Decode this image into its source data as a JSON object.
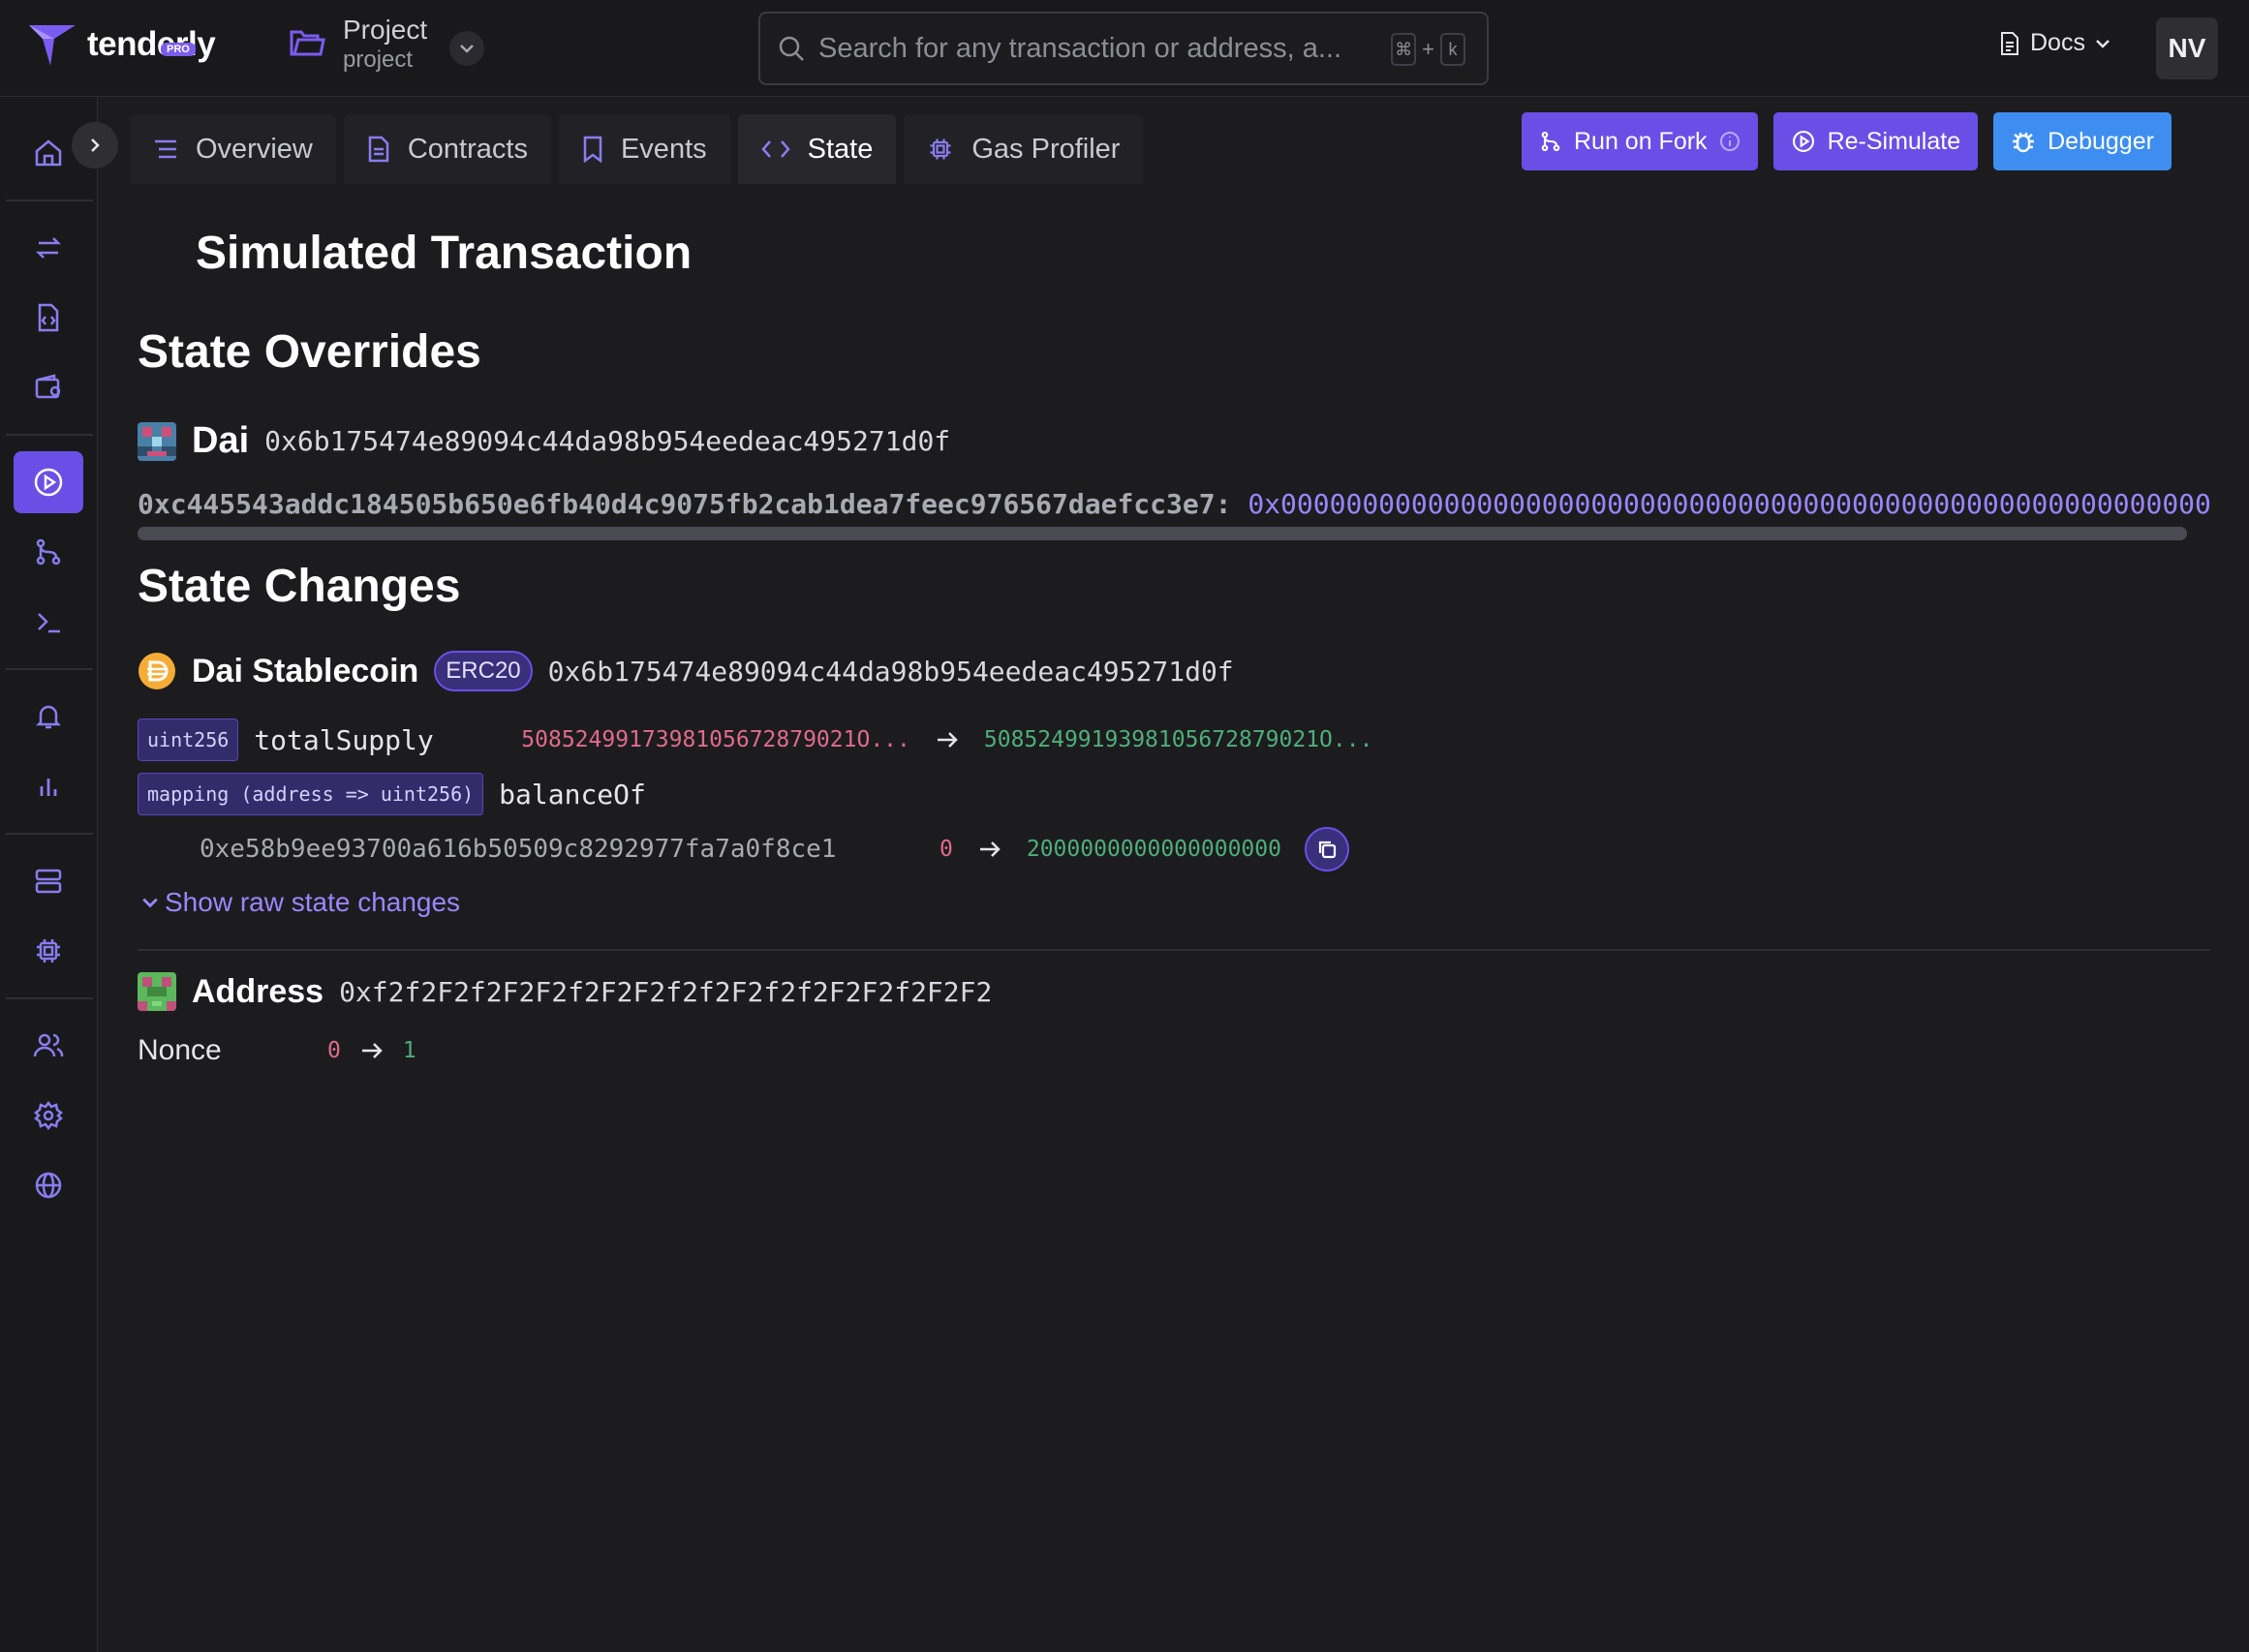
{
  "brand": {
    "name": "tenderly",
    "plan": "PRO"
  },
  "project": {
    "title": "Project",
    "subtitle": "project"
  },
  "search": {
    "placeholder": "Search for any transaction or address, a...",
    "shortcut_mod": "⌘",
    "shortcut_plus": "+",
    "shortcut_key": "k"
  },
  "header": {
    "docs_label": "Docs",
    "avatar_initials": "NV"
  },
  "tabs": [
    {
      "label": "Overview",
      "icon": "list-icon"
    },
    {
      "label": "Contracts",
      "icon": "file-icon"
    },
    {
      "label": "Events",
      "icon": "bookmark-icon"
    },
    {
      "label": "State",
      "icon": "code-icon",
      "active": true
    },
    {
      "label": "Gas Profiler",
      "icon": "chip-icon"
    }
  ],
  "actions": {
    "run_on_fork": "Run on Fork",
    "resimulate": "Re-Simulate",
    "debugger": "Debugger"
  },
  "page": {
    "title": "Simulated Transaction"
  },
  "overrides": {
    "heading": "State Overrides",
    "contract_name": "Dai",
    "contract_address": "0x6b175474e89094c44da98b954eedeac495271d0f",
    "slot": "0xc445543addc184505b650e6fb40d4c9075fb2cab1dea7feec976567daefcc3e7:",
    "value": "0x0000000000000000000000000000000000000000000000000000000000"
  },
  "changes": {
    "heading": "State Changes",
    "contract": {
      "name": "Dai Stablecoin",
      "badge": "ERC20",
      "address": "0x6b175474e89094c44da98b954eedeac495271d0f",
      "total_supply": {
        "type": "uint256",
        "name": "totalSupply",
        "old": "5085249917398105672879021O...",
        "new": "5085249919398105672879021O..."
      },
      "balance_of": {
        "type": "mapping (address => uint256)",
        "name": "balanceOf",
        "key": "0xe58b9ee93700a616b50509c8292977fa7a0f8ce1",
        "old": "0",
        "new": "2000000000000000000"
      },
      "raw_link": "Show raw state changes"
    },
    "address_entry": {
      "label": "Address",
      "address": "0xf2f2F2f2F2F2f2F2F2f2f2F2f2f2F2F2f2F2F2",
      "nonce_label": "Nonce",
      "nonce_old": "0",
      "nonce_new": "1"
    }
  },
  "colors": {
    "accent": "#6a4fe6",
    "debugger": "#3d8ef0",
    "old_value": "#e06b8a",
    "new_value": "#4fae7a"
  }
}
